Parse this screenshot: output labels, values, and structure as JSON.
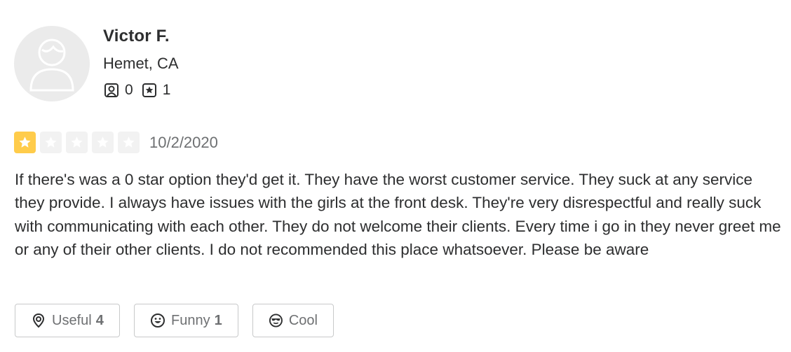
{
  "user": {
    "name": "Victor F.",
    "location": "Hemet, CA",
    "friends_count": "0",
    "reviews_count": "1"
  },
  "review": {
    "rating": 1,
    "rating_max": 5,
    "date": "10/2/2020",
    "text": "If there's was a 0 star option they'd get it. They have the worst customer service. They suck at any service they provide. I always have issues with the girls at the front desk. They're very disrespectful and really suck with communicating with each other. They do not welcome their clients. Every time i go in they never greet me or any of their other clients. I do not recommended this place whatsoever. Please be aware"
  },
  "reactions": {
    "useful_label": "Useful",
    "useful_count": "4",
    "funny_label": "Funny",
    "funny_count": "1",
    "cool_label": "Cool"
  },
  "colors": {
    "star_active": "#ffcc4b",
    "star_inactive": "#f2f2f2",
    "text": "#2d2e2f",
    "muted": "#6e7072"
  },
  "icons": [
    "user-avatar-icon",
    "friends-icon",
    "reviews-star-icon",
    "star-icon",
    "useful-lightbulb-icon",
    "funny-smile-icon",
    "cool-sunglasses-icon"
  ]
}
